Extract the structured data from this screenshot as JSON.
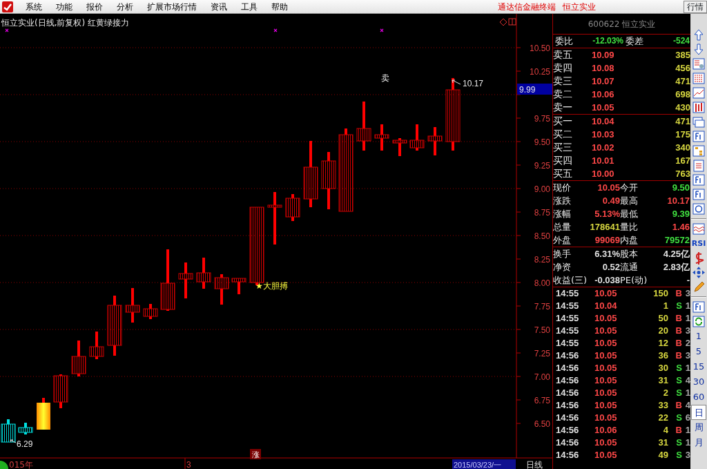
{
  "menu": {
    "items": [
      "系统",
      "功能",
      "报价",
      "分析",
      "扩展市场行情",
      "资讯",
      "工具",
      "帮助"
    ],
    "app_name": "通达信金融终端",
    "stock_name": "恒立实业",
    "tab": "行情"
  },
  "chart": {
    "title": "恒立实业(日线,前复权) 红黄绿接力",
    "price_axis": [
      "10.50",
      "10.25",
      "9.75",
      "9.50",
      "9.25",
      "9.00",
      "8.75",
      "8.50",
      "8.25",
      "8.00",
      "7.75",
      "7.50",
      "7.25",
      "7.00",
      "6.75",
      "6.50"
    ],
    "current_price": "9.99",
    "sell_signal": "卖",
    "high_label": "10.17",
    "low_label": "6.29",
    "buy_signal": "★大胆搏",
    "rise_badge": "涨",
    "x_axis": {
      "year": "015年",
      "month": "3",
      "date": "2015/03/23/一",
      "period": "日线"
    }
  },
  "quote": {
    "header": "600622 恒立实业",
    "ratio": [
      {
        "label": "委比",
        "value": "-12.03%",
        "color": "#40e040"
      },
      {
        "label": "委差",
        "value": "-524",
        "color": "#40e040"
      }
    ],
    "asks": [
      {
        "label": "卖五",
        "price": "10.09",
        "volume": "385"
      },
      {
        "label": "卖四",
        "price": "10.08",
        "volume": "456"
      },
      {
        "label": "卖三",
        "price": "10.07",
        "volume": "471"
      },
      {
        "label": "卖二",
        "price": "10.06",
        "volume": "698"
      },
      {
        "label": "卖一",
        "price": "10.05",
        "volume": "430"
      }
    ],
    "bids": [
      {
        "label": "买一",
        "price": "10.04",
        "volume": "471"
      },
      {
        "label": "买二",
        "price": "10.03",
        "volume": "175"
      },
      {
        "label": "买三",
        "price": "10.02",
        "volume": "340"
      },
      {
        "label": "买四",
        "price": "10.01",
        "volume": "167"
      },
      {
        "label": "买五",
        "price": "10.00",
        "volume": "763"
      }
    ],
    "stats": [
      {
        "label": "现价",
        "value": "10.05",
        "color": "#ff4848"
      },
      {
        "label": "今开",
        "value": "9.50",
        "color": "#40e040"
      },
      {
        "label": "涨跌",
        "value": "0.49",
        "color": "#ff4848"
      },
      {
        "label": "最高",
        "value": "10.17",
        "color": "#ff4848"
      },
      {
        "label": "涨幅",
        "value": "5.13%",
        "color": "#ff4848"
      },
      {
        "label": "最低",
        "value": "9.39",
        "color": "#40e040"
      },
      {
        "label": "总量",
        "value": "178641",
        "color": "#d8d840"
      },
      {
        "label": "量比",
        "value": "1.46",
        "color": "#ff4848"
      },
      {
        "label": "外盘",
        "value": "99069",
        "color": "#ff4848"
      },
      {
        "label": "内盘",
        "value": "79572",
        "color": "#40e040"
      }
    ],
    "fundamentals": [
      {
        "label": "换手",
        "value": "6.31%"
      },
      {
        "label": "股本",
        "value": "4.25亿"
      },
      {
        "label": "净资",
        "value": "0.52"
      },
      {
        "label": "流通",
        "value": "2.83亿"
      },
      {
        "label": "收益(三)",
        "value": "-0.038"
      },
      {
        "label": "PE(动)",
        "value": "-"
      }
    ]
  },
  "trades": [
    {
      "time": "14:55",
      "price": "10.05",
      "volume": "150",
      "side": "B",
      "color": "#ff4848",
      "count": "3"
    },
    {
      "time": "14:55",
      "price": "10.04",
      "volume": "1",
      "side": "S",
      "color": "#40e040",
      "count": "1"
    },
    {
      "time": "14:55",
      "price": "10.05",
      "volume": "50",
      "side": "B",
      "color": "#ff4848",
      "count": "1"
    },
    {
      "time": "14:55",
      "price": "10.05",
      "volume": "20",
      "side": "B",
      "color": "#ff4848",
      "count": "3"
    },
    {
      "time": "14:55",
      "price": "10.05",
      "volume": "12",
      "side": "B",
      "color": "#ff4848",
      "count": "2"
    },
    {
      "time": "14:56",
      "price": "10.05",
      "volume": "36",
      "side": "B",
      "color": "#ff4848",
      "count": "3"
    },
    {
      "time": "14:56",
      "price": "10.05",
      "volume": "30",
      "side": "S",
      "color": "#40e040",
      "count": "1"
    },
    {
      "time": "14:56",
      "price": "10.05",
      "volume": "31",
      "side": "S",
      "color": "#40e040",
      "count": "4"
    },
    {
      "time": "14:56",
      "price": "10.05",
      "volume": "2",
      "side": "S",
      "color": "#40e040",
      "count": "1"
    },
    {
      "time": "14:56",
      "price": "10.05",
      "volume": "33",
      "side": "B",
      "color": "#ff4848",
      "count": "4"
    },
    {
      "time": "14:56",
      "price": "10.05",
      "volume": "22",
      "side": "S",
      "color": "#40e040",
      "count": "6"
    },
    {
      "time": "14:56",
      "price": "10.06",
      "volume": "4",
      "side": "B",
      "color": "#ff4848",
      "count": "1"
    },
    {
      "time": "14:56",
      "price": "10.05",
      "volume": "31",
      "side": "S",
      "color": "#40e040",
      "count": "1"
    },
    {
      "time": "14:56",
      "price": "10.05",
      "volume": "49",
      "side": "S",
      "color": "#40e040",
      "count": "3"
    }
  ],
  "toolbar": {
    "tools": [
      {
        "kind": "arrow-up"
      },
      {
        "kind": "arrow-down"
      },
      {
        "kind": "table"
      },
      {
        "kind": "grid"
      },
      {
        "kind": "line"
      },
      {
        "kind": "candles"
      },
      {
        "kind": "windows"
      },
      {
        "kind": "box"
      },
      {
        "kind": "tree"
      },
      {
        "kind": "clipboard"
      },
      {
        "kind": "box"
      },
      {
        "kind": "box"
      },
      {
        "kind": "circle"
      },
      {
        "kind": "separator"
      },
      {
        "kind": "wave"
      },
      {
        "kind": "text",
        "label": "RSI"
      },
      {
        "kind": "dollar"
      },
      {
        "kind": "move"
      },
      {
        "kind": "pencil"
      },
      {
        "kind": "separator"
      },
      {
        "kind": "box"
      },
      {
        "kind": "refresh"
      }
    ],
    "periods": [
      {
        "label": "1",
        "selected": false
      },
      {
        "label": "5",
        "selected": false
      },
      {
        "label": "15",
        "selected": false
      },
      {
        "label": "30",
        "selected": false
      },
      {
        "label": "60",
        "selected": false
      },
      {
        "label": "日",
        "selected": true
      },
      {
        "label": "周",
        "selected": false
      },
      {
        "label": "月",
        "selected": false
      }
    ]
  }
}
